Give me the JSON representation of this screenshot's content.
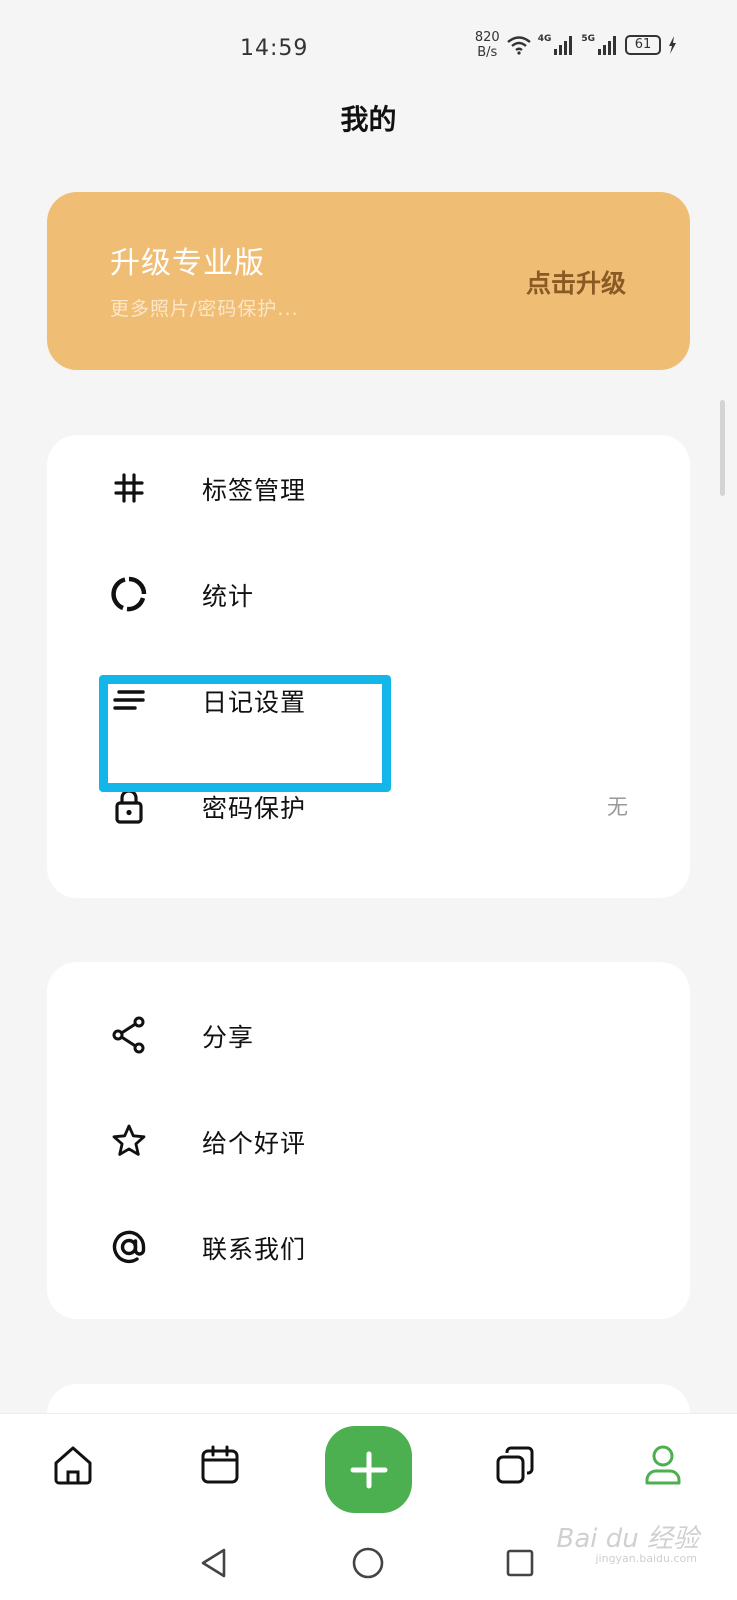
{
  "status_bar": {
    "time": "14:59",
    "net_speed_value": "820",
    "net_speed_unit": "B/s",
    "signal1_label": "4G",
    "signal2_label": "5G",
    "battery": "61"
  },
  "header": {
    "title": "我的"
  },
  "upgrade": {
    "title": "升级专业版",
    "subtitle": "更多照片/密码保护...",
    "button_label": "点击升级",
    "background_color": "#f0bd75"
  },
  "menu_group1": {
    "items": [
      {
        "label": "标签管理",
        "icon": "hashtag-icon"
      },
      {
        "label": "统计",
        "icon": "stats-ring-icon"
      },
      {
        "label": "日记设置",
        "icon": "lines-icon"
      },
      {
        "label": "密码保护",
        "icon": "lock-icon",
        "value": "无"
      }
    ]
  },
  "menu_group2": {
    "items": [
      {
        "label": "分享",
        "icon": "share-icon"
      },
      {
        "label": "给个好评",
        "icon": "star-icon"
      },
      {
        "label": "联系我们",
        "icon": "at-icon"
      }
    ]
  },
  "highlight_color": "#13b6e8",
  "bottom_nav": {
    "items": [
      "home-icon",
      "calendar-icon",
      "add-icon",
      "cards-icon",
      "profile-icon"
    ],
    "active": "profile-icon",
    "accent_color": "#4caf50"
  },
  "watermark": {
    "text": "Bai du 经验",
    "sub": "jingyan.baidu.com"
  }
}
